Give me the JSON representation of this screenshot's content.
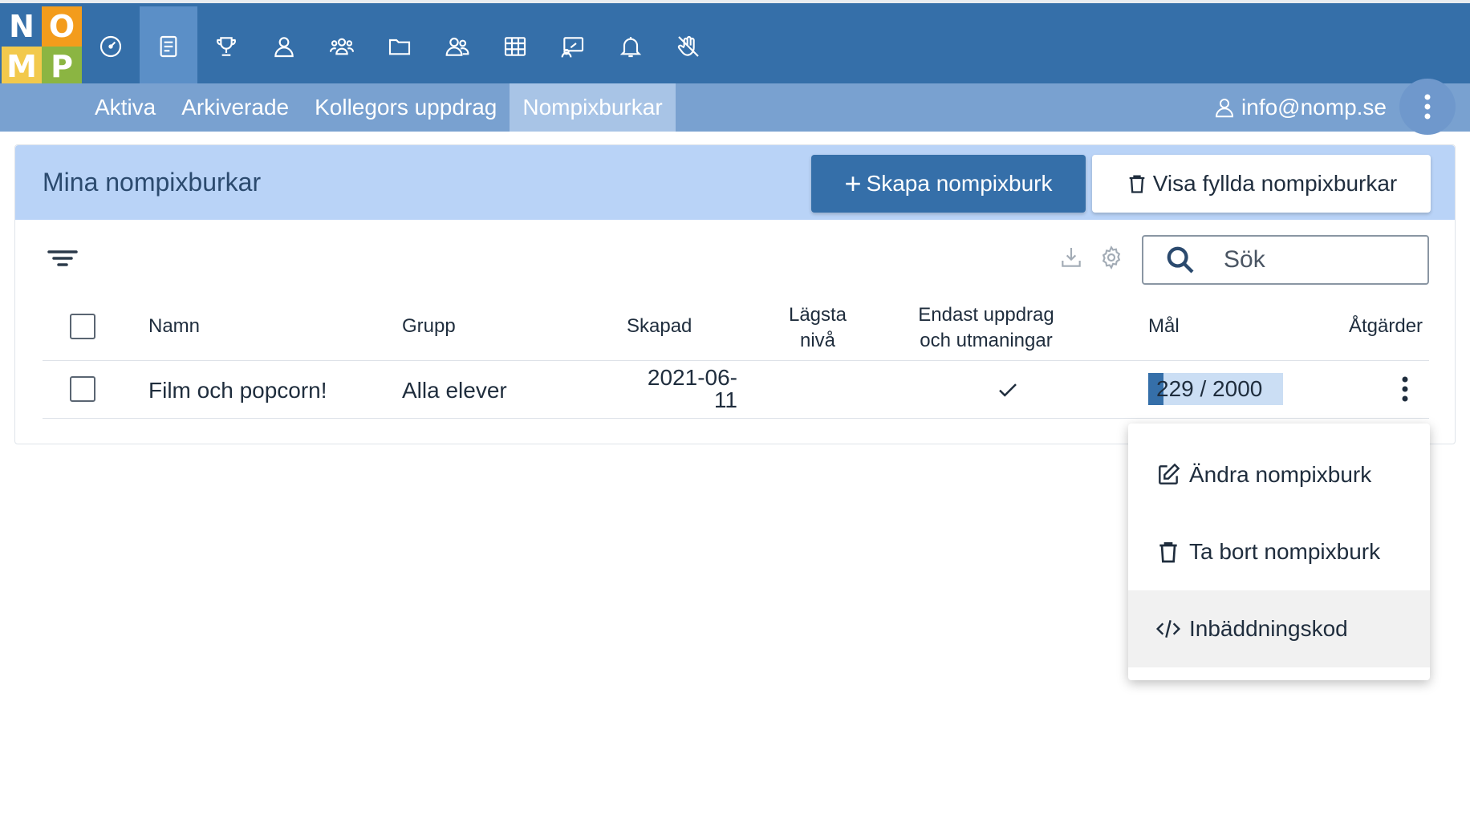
{
  "logo": {
    "letters": [
      "N",
      "O",
      "M",
      "P"
    ],
    "colors": [
      "#356fa9",
      "#f39c1c",
      "#f2c94c",
      "#8bb542"
    ]
  },
  "nav_icons": [
    "speedometer-icon",
    "notebook-icon",
    "trophy-icon",
    "person-icon",
    "group-icon",
    "folder-icon",
    "people-icon",
    "grid-table-icon",
    "presentation-icon",
    "bell-icon",
    "hand-off-icon"
  ],
  "subnav": {
    "tabs": [
      "Aktiva",
      "Arkiverade",
      "Kollegors uppdrag",
      "Nompixburkar"
    ],
    "active_tab": "Nompixburkar",
    "user_email": "info@nomp.se"
  },
  "card": {
    "title": "Mina nompixburkar",
    "create_button": "Skapa nompixburk",
    "create_button_symbol": "+",
    "filled_button": "Visa fyllda nompixburkar"
  },
  "search": {
    "placeholder": "Sök"
  },
  "table": {
    "columns": {
      "name": "Namn",
      "group": "Grupp",
      "created": "Skapad",
      "lowest_level_line1": "Lägsta",
      "lowest_level_line2": "nivå",
      "only_assignments_line1": "Endast uppdrag",
      "only_assignments_line2": "och utmaningar",
      "goal": "Mål",
      "actions": "Åtgärder"
    },
    "rows": [
      {
        "name": "Film och popcorn!",
        "group": "Alla elever",
        "created_line1": "2021-06-",
        "created_line2": "11",
        "lowest_level": "",
        "only_assignments": true,
        "goal_text": "229 / 2000",
        "goal_progress": 0.1145
      }
    ]
  },
  "context_menu": {
    "items": [
      {
        "label": "Ändra nompixburk",
        "icon": "edit-icon"
      },
      {
        "label": "Ta bort nompixburk",
        "icon": "trash-icon"
      },
      {
        "label": "Inbäddningskod",
        "icon": "code-icon"
      }
    ]
  },
  "colors": {
    "primary": "#356fa9",
    "subbar": "#79a1d0",
    "card_header": "#b9d3f7",
    "goal_track": "#cbdef4"
  }
}
